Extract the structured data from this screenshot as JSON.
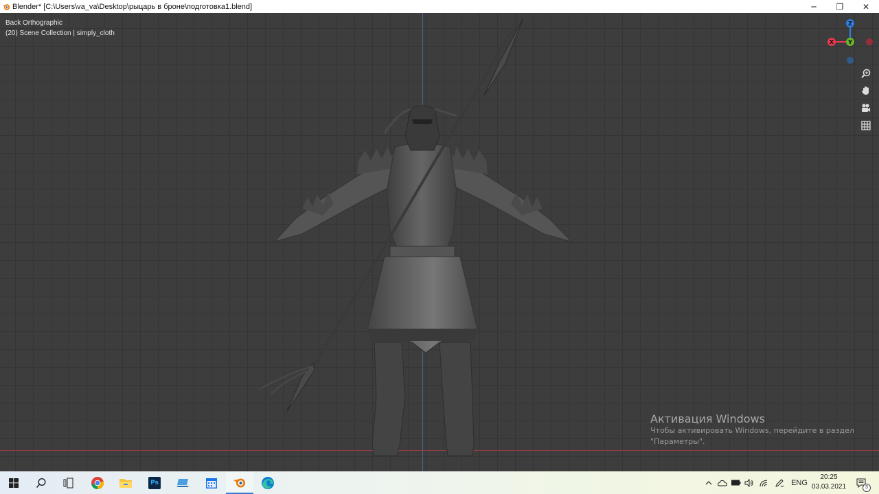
{
  "window": {
    "title": "Blender* [C:\\Users\\va_va\\Desktop\\рыцарь в броне\\подготовка1.blend]",
    "minimize_glyph": "─",
    "maximize_glyph": "❐",
    "close_glyph": "✕"
  },
  "viewport": {
    "view_name": "Back Orthographic",
    "collection_info": "(20) Scene Collection | simply_cloth"
  },
  "gizmo": {
    "z_label": "Z",
    "y_label": "Y",
    "x_label": "X",
    "z_color": "#2f7fe0",
    "y_color": "#6ab32a",
    "x_color": "#e8384f",
    "neg_x_color": "#9b2d3a",
    "neg_y_color": "#2f5a8a"
  },
  "nav_tools": [
    "zoom-icon",
    "hand-icon",
    "camera-icon",
    "grid-icon"
  ],
  "watermark": {
    "title": "Активация Windows",
    "line1": "Чтобы активировать Windows, перейдите в раздел",
    "line2": "\"Параметры\"."
  },
  "taskbar": {
    "apps": [
      "windows-start-icon",
      "search-icon",
      "task-view-icon",
      "chrome-icon",
      "file-explorer-icon",
      "photoshop-icon",
      "laptop-icon",
      "calendar-icon",
      "blender-icon",
      "edge-icon"
    ],
    "photoshop_label": "Ps",
    "language": "ENG",
    "time": "20:25",
    "date": "03.03.2021",
    "notification_count": "3"
  }
}
